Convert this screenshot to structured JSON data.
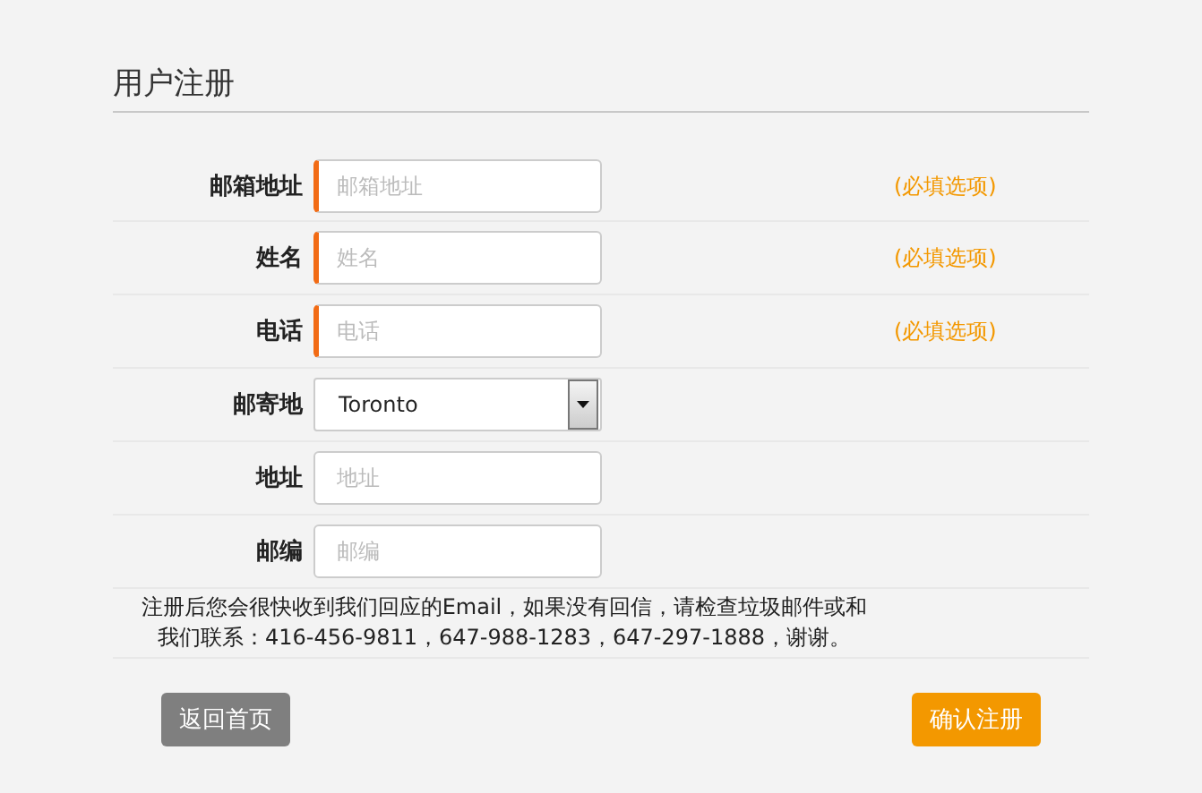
{
  "title": "用户注册",
  "fields": [
    {
      "kind": "text",
      "label": "邮箱地址",
      "placeholder": "邮箱地址",
      "required": true,
      "note": "(必填选项)"
    },
    {
      "kind": "text",
      "label": "姓名",
      "placeholder": "姓名",
      "required": true,
      "note": "(必填选项)"
    },
    {
      "kind": "text",
      "label": "电话",
      "placeholder": "电话",
      "required": true,
      "note": "(必填选项)"
    },
    {
      "kind": "select",
      "label": "邮寄地",
      "value": "Toronto",
      "required": false
    },
    {
      "kind": "text",
      "label": "地址",
      "placeholder": "地址",
      "required": false
    },
    {
      "kind": "text",
      "label": "邮编",
      "placeholder": "邮编",
      "required": false
    }
  ],
  "notice": [
    "注册后您会很快收到我们回应的Email，如果没有回信，请检查垃圾邮件或和",
    "我们联系：416-456-9811，647-988-1283，647-297-1888，谢谢。"
  ],
  "buttons": [
    {
      "kind": "secondary",
      "label": "返回首页"
    },
    {
      "kind": "primary",
      "label": "确认注册"
    }
  ]
}
